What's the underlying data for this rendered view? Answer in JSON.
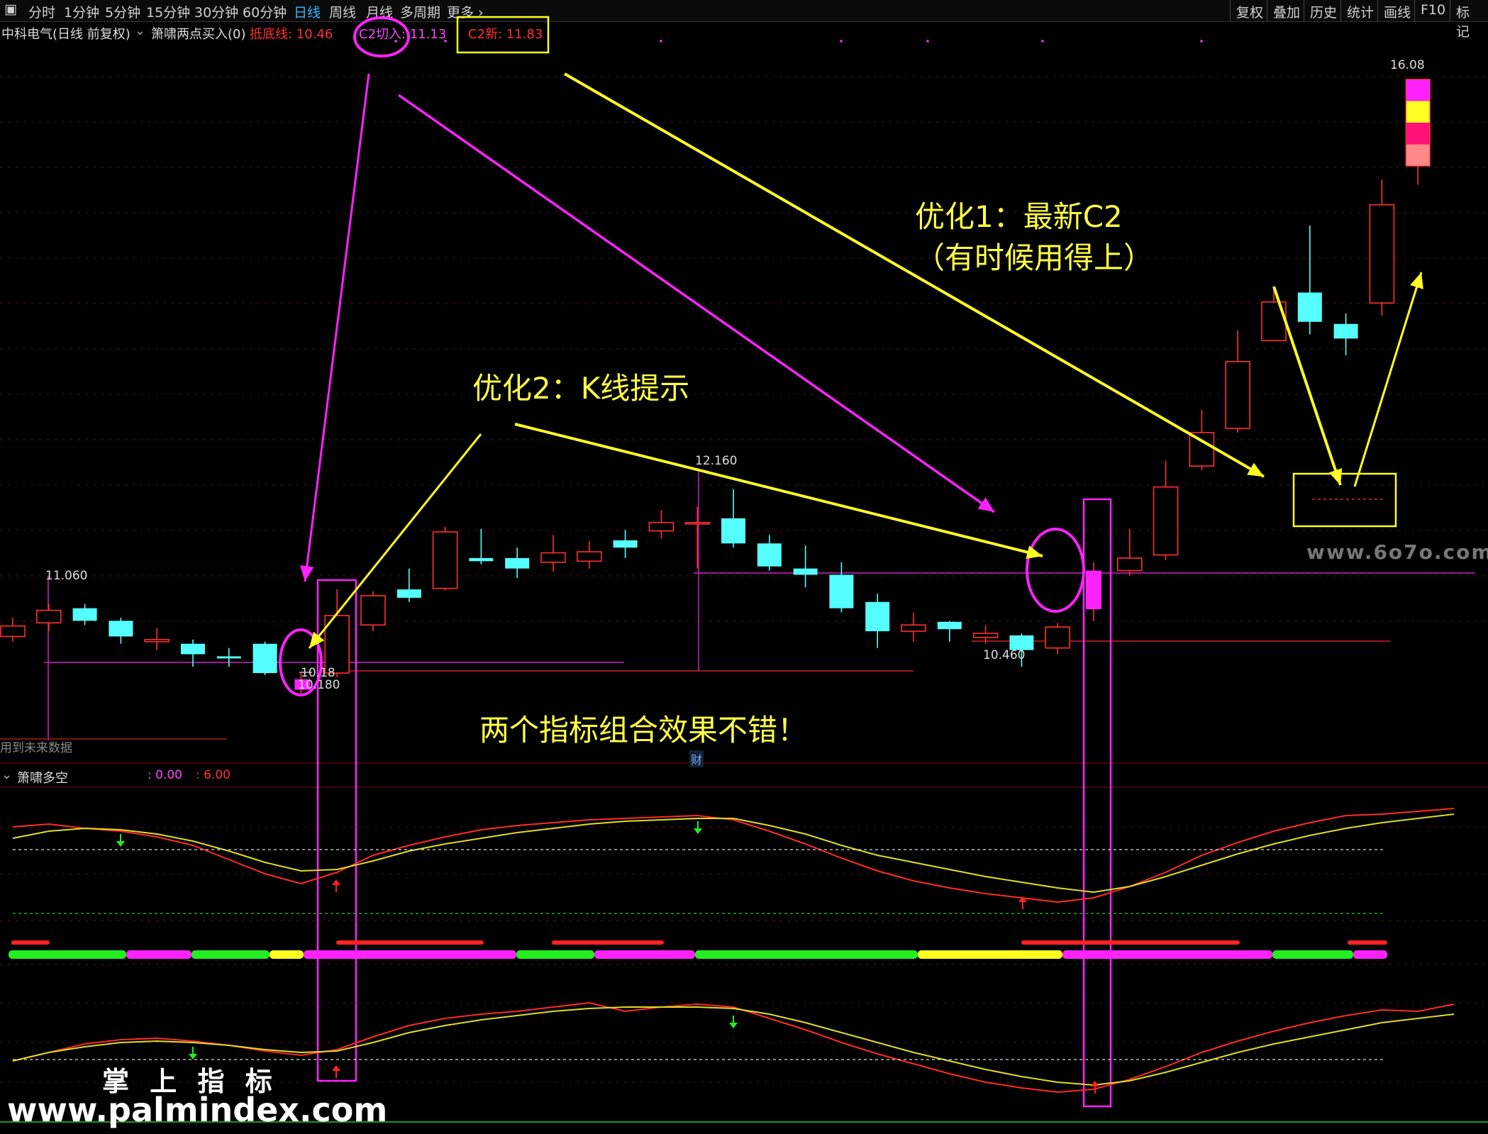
{
  "toolbar": {
    "periods": [
      "分时",
      "1分钟",
      "5分钟",
      "15分钟",
      "30分钟",
      "60分钟",
      "日线",
      "周线",
      "月线",
      "多周期",
      "更多"
    ],
    "active_period": "日线",
    "right_buttons": [
      "复权",
      "叠加",
      "历史",
      "统计",
      "画线",
      "F10",
      "标记"
    ]
  },
  "main_chart": {
    "title": "中科电气(日线 前复权)",
    "indicator": "箫啸两点买入(0)",
    "legend": [
      {
        "label": "抵底线: 10.46",
        "color": "#ff3030"
      },
      {
        "label": "C2切入: 11.13",
        "color": "#ff44ff"
      },
      {
        "label": "C2新: 11.83",
        "color": "#ff3030"
      }
    ],
    "price_labels": {
      "high_right": "16.08",
      "peak_mid": "12.160",
      "left_high": "11.060",
      "low_left": "10.180",
      "low_left_arrow": "10.18",
      "low_right": "10.460"
    },
    "future_data_note": "用到未来数据",
    "finance_marker": "财",
    "watermark_site": "www.6o7o.com"
  },
  "candles": [
    {
      "o": 10.75,
      "c": 10.85,
      "h": 10.93,
      "l": 10.7
    },
    {
      "o": 10.88,
      "c": 11.0,
      "h": 11.06,
      "l": 10.8
    },
    {
      "o": 11.02,
      "c": 10.9,
      "h": 11.06,
      "l": 10.86
    },
    {
      "o": 10.9,
      "c": 10.75,
      "h": 10.93,
      "l": 10.68
    },
    {
      "o": 10.7,
      "c": 10.72,
      "h": 10.83,
      "l": 10.62
    },
    {
      "o": 10.68,
      "c": 10.58,
      "h": 10.72,
      "l": 10.46
    },
    {
      "o": 10.56,
      "c": 10.54,
      "h": 10.64,
      "l": 10.46
    },
    {
      "o": 10.68,
      "c": 10.4,
      "h": 10.7,
      "l": 10.38
    },
    {
      "o": 10.24,
      "c": 10.34,
      "h": 10.4,
      "l": 10.18,
      "k": "m"
    },
    {
      "o": 10.4,
      "c": 10.95,
      "h": 11.2,
      "l": 10.36
    },
    {
      "o": 10.86,
      "c": 11.14,
      "h": 11.18,
      "l": 10.8
    },
    {
      "o": 11.2,
      "c": 11.12,
      "h": 11.4,
      "l": 11.08
    },
    {
      "o": 11.21,
      "c": 11.75,
      "h": 11.8,
      "l": 11.19
    },
    {
      "o": 11.5,
      "c": 11.47,
      "h": 11.78,
      "l": 11.44
    },
    {
      "o": 11.5,
      "c": 11.4,
      "h": 11.6,
      "l": 11.31
    },
    {
      "o": 11.46,
      "c": 11.55,
      "h": 11.72,
      "l": 11.37
    },
    {
      "o": 11.47,
      "c": 11.56,
      "h": 11.66,
      "l": 11.4
    },
    {
      "o": 11.67,
      "c": 11.6,
      "h": 11.77,
      "l": 11.5
    },
    {
      "o": 11.76,
      "c": 11.84,
      "h": 11.96,
      "l": 11.69
    },
    {
      "o": 11.84,
      "c": 11.84,
      "h": 11.99,
      "l": 11.4
    },
    {
      "o": 11.88,
      "c": 11.64,
      "h": 12.16,
      "l": 11.6
    },
    {
      "o": 11.64,
      "c": 11.42,
      "h": 11.72,
      "l": 11.38
    },
    {
      "o": 11.4,
      "c": 11.34,
      "h": 11.62,
      "l": 11.22
    },
    {
      "o": 11.34,
      "c": 11.02,
      "h": 11.46,
      "l": 10.98
    },
    {
      "o": 11.08,
      "c": 10.8,
      "h": 11.16,
      "l": 10.64
    },
    {
      "o": 10.8,
      "c": 10.86,
      "h": 10.98,
      "l": 10.7
    },
    {
      "o": 10.89,
      "c": 10.82,
      "h": 10.9,
      "l": 10.7
    },
    {
      "o": 10.74,
      "c": 10.78,
      "h": 10.86,
      "l": 10.68
    },
    {
      "o": 10.76,
      "c": 10.62,
      "h": 10.78,
      "l": 10.46
    },
    {
      "o": 10.64,
      "c": 10.84,
      "h": 10.88,
      "l": 10.58
    },
    {
      "o": 11.01,
      "c": 11.38,
      "h": 11.46,
      "l": 10.9,
      "k": "m"
    },
    {
      "o": 11.38,
      "c": 11.5,
      "h": 11.78,
      "l": 11.33
    },
    {
      "o": 11.53,
      "c": 12.18,
      "h": 12.43,
      "l": 11.48
    },
    {
      "o": 12.38,
      "c": 12.7,
      "h": 12.92,
      "l": 12.34
    },
    {
      "o": 12.74,
      "c": 13.38,
      "h": 13.68,
      "l": 12.7
    },
    {
      "o": 13.58,
      "c": 13.95,
      "h": 14.08,
      "l": 13.58
    },
    {
      "o": 14.04,
      "c": 13.76,
      "h": 14.68,
      "l": 13.64
    },
    {
      "o": 13.74,
      "c": 13.6,
      "h": 13.84,
      "l": 13.44
    },
    {
      "o": 13.94,
      "c": 14.88,
      "h": 15.12,
      "l": 13.82
    },
    {
      "o": 15.25,
      "c": 16.08,
      "h": 16.08,
      "l": 15.07,
      "k": "stack"
    }
  ],
  "oscillator": {
    "title": "箫啸多空",
    "values": [
      {
        "label": ": 0.00",
        "color": "#ff44ff"
      },
      {
        "label": ": 6.00",
        "color": "#ff3030"
      }
    ]
  },
  "annotations": {
    "opt1_line1": "优化1：最新C2",
    "opt1_line2": "（有时候用得上）",
    "opt2": "优化2：K线提示",
    "combo": "两个指标组合效果不错！"
  },
  "watermark": {
    "brand": "掌 上 指 标",
    "site": "www.palmindex.com"
  },
  "colors": {
    "up": "#ff3030",
    "down": "#55ffff",
    "magenta": "#ff22ff",
    "yellow": "#ffff22",
    "green": "#22ee22"
  }
}
